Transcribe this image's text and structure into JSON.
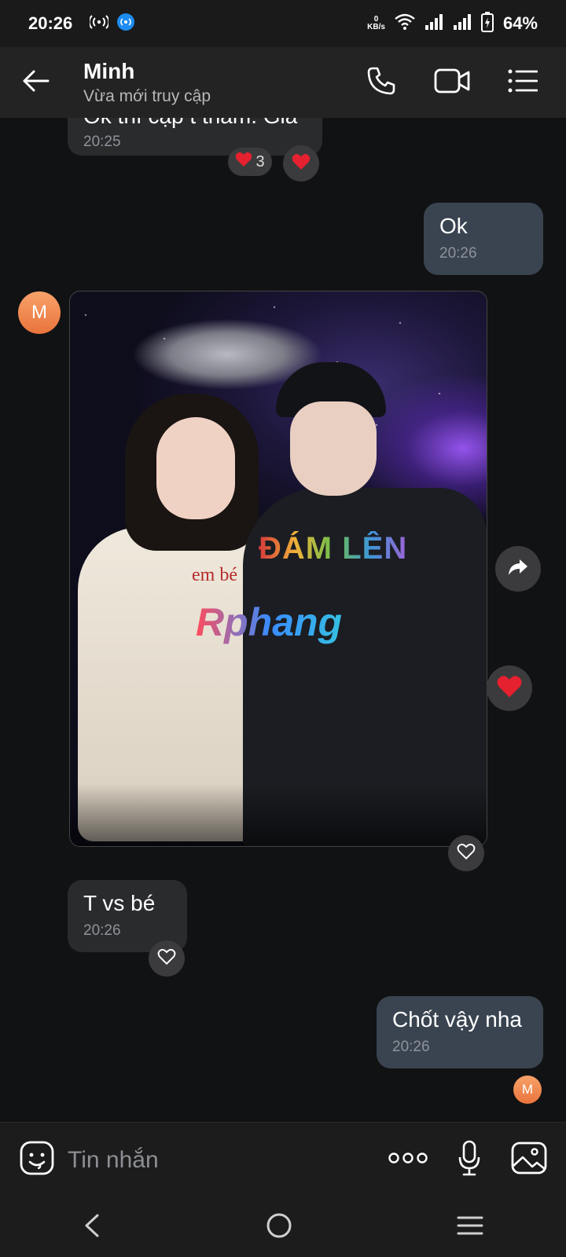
{
  "status_bar": {
    "time": "20:26",
    "net_speed_value": "0",
    "net_speed_unit": "KB/s",
    "battery": "64%"
  },
  "header": {
    "contact_name": "Minh",
    "contact_status": "Vừa mới truy cập"
  },
  "messages": [
    {
      "id": "m1",
      "direction": "in",
      "text": "Ok thì cập t thấm. Giá",
      "time": "20:25",
      "reaction_count": "3"
    },
    {
      "id": "m2",
      "direction": "out",
      "text": "Ok",
      "time": "20:26"
    },
    {
      "id": "m3",
      "direction": "in",
      "type": "image",
      "avatar_letter": "M",
      "photo_shirt_text": "ĐÁM LÊN",
      "photo_tee_text": "em bé",
      "photo_watermark": "Rphang"
    },
    {
      "id": "m4",
      "direction": "in",
      "text": "T vs bé",
      "time": "20:26"
    },
    {
      "id": "m5",
      "direction": "out",
      "text": "Chốt vậy nha",
      "time": "20:26",
      "seen_avatar_letter": "M"
    }
  ],
  "composer": {
    "placeholder": "Tin nhắn"
  },
  "icons": {
    "back": "arrow-left-icon",
    "call": "phone-icon",
    "video": "video-camera-icon",
    "menu": "list-icon",
    "sticker": "smiley-icon",
    "more": "more-dots-icon",
    "mic": "microphone-icon",
    "gallery": "image-icon",
    "share": "share-forward-icon",
    "heart": "heart-icon"
  },
  "colors": {
    "background": "#111213",
    "incoming_bubble": "#2a2b2d",
    "outgoing_bubble": "#3a4451",
    "heart": "#e5212f",
    "avatar": "#f08a4b"
  }
}
